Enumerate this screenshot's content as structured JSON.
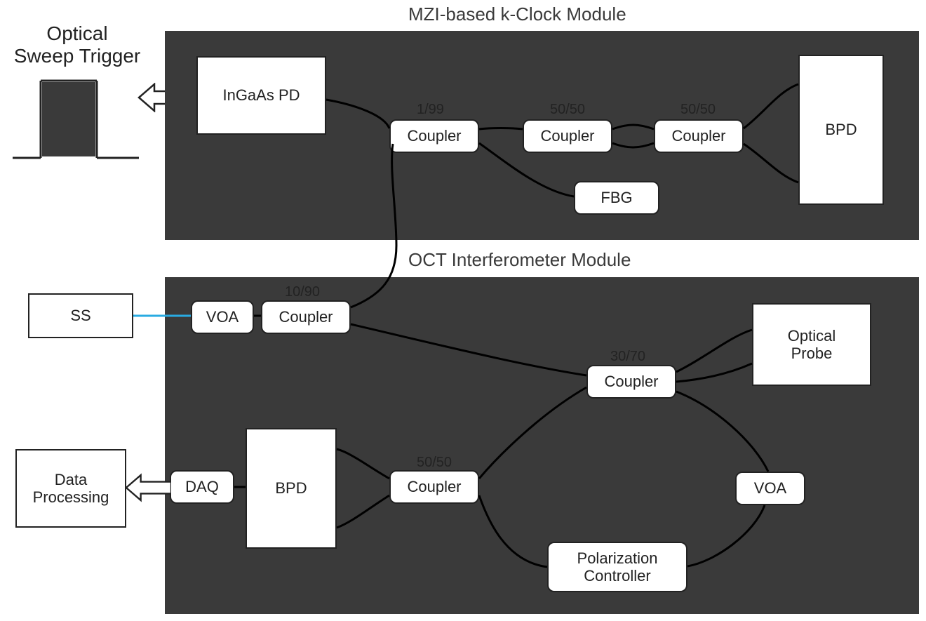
{
  "trigger_label": "Optical\nSweep Trigger",
  "modules": {
    "kclock": {
      "title": "MZI-based k-Clock Module",
      "blocks": {
        "ingaas_pd": "InGaAs PD",
        "coupler1": "Coupler",
        "coupler1_ratio": "1/99",
        "coupler2": "Coupler",
        "coupler2_ratio": "50/50",
        "coupler3": "Coupler",
        "coupler3_ratio": "50/50",
        "fbg": "FBG",
        "bpd": "BPD"
      }
    },
    "oct": {
      "title": "OCT Interferometer Module",
      "blocks": {
        "ss": "SS",
        "voa1": "VOA",
        "coupler_a": "Coupler",
        "coupler_a_ratio": "10/90",
        "daq": "DAQ",
        "bpd": "BPD",
        "coupler_b": "Coupler",
        "coupler_b_ratio": "50/50",
        "coupler_c": "Coupler",
        "coupler_c_ratio": "30/70",
        "optical_probe": "Optical\nProbe",
        "voa2": "VOA",
        "pol_ctrl": "Polarization\nController",
        "data_proc": "Data\nProcessing"
      }
    }
  },
  "colors": {
    "module_bg": "#3a3a3a",
    "wire": "#000000",
    "blue_wire": "#29abe2"
  }
}
